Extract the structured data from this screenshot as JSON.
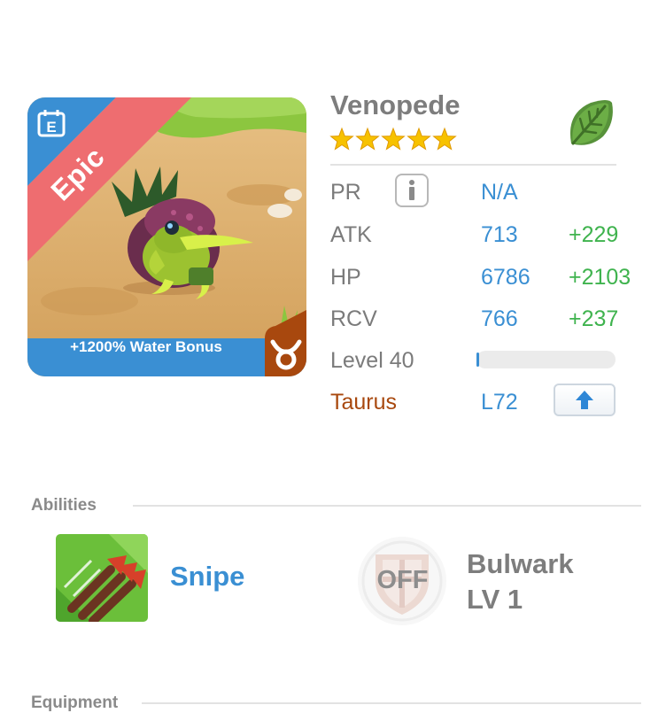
{
  "monster": {
    "name": "Venopede",
    "stars": 5,
    "rarity": "Epic",
    "bonus": "+1200% Water Bonus",
    "element_icon": "leaf-icon",
    "sign_icon": "taurus-icon"
  },
  "stats": {
    "pr_label": "PR",
    "pr_value": "N/A",
    "atk_label": "ATK",
    "atk_value": "713",
    "atk_bonus": "+229",
    "hp_label": "HP",
    "hp_value": "6786",
    "hp_bonus": "+2103",
    "rcv_label": "RCV",
    "rcv_value": "766",
    "rcv_bonus": "+237",
    "level_label": "Level 40",
    "level_progress": 0.02,
    "sign_label": "Taurus",
    "sign_value": "L72"
  },
  "abilities": {
    "title": "Abilities",
    "items": [
      {
        "name": "Snipe",
        "icon": "arrows-icon"
      },
      {
        "name": "Bulwark",
        "level": "LV 1",
        "status": "OFF",
        "icon": "shield-icon"
      }
    ]
  },
  "equipment": {
    "title": "Equipment"
  },
  "colors": {
    "accent_blue": "#3a8fd3",
    "bonus_green": "#3fb34e",
    "taurus_brown": "#a8480e",
    "epic_red": "#ee6d70",
    "star_yellow": "#f7c200"
  }
}
